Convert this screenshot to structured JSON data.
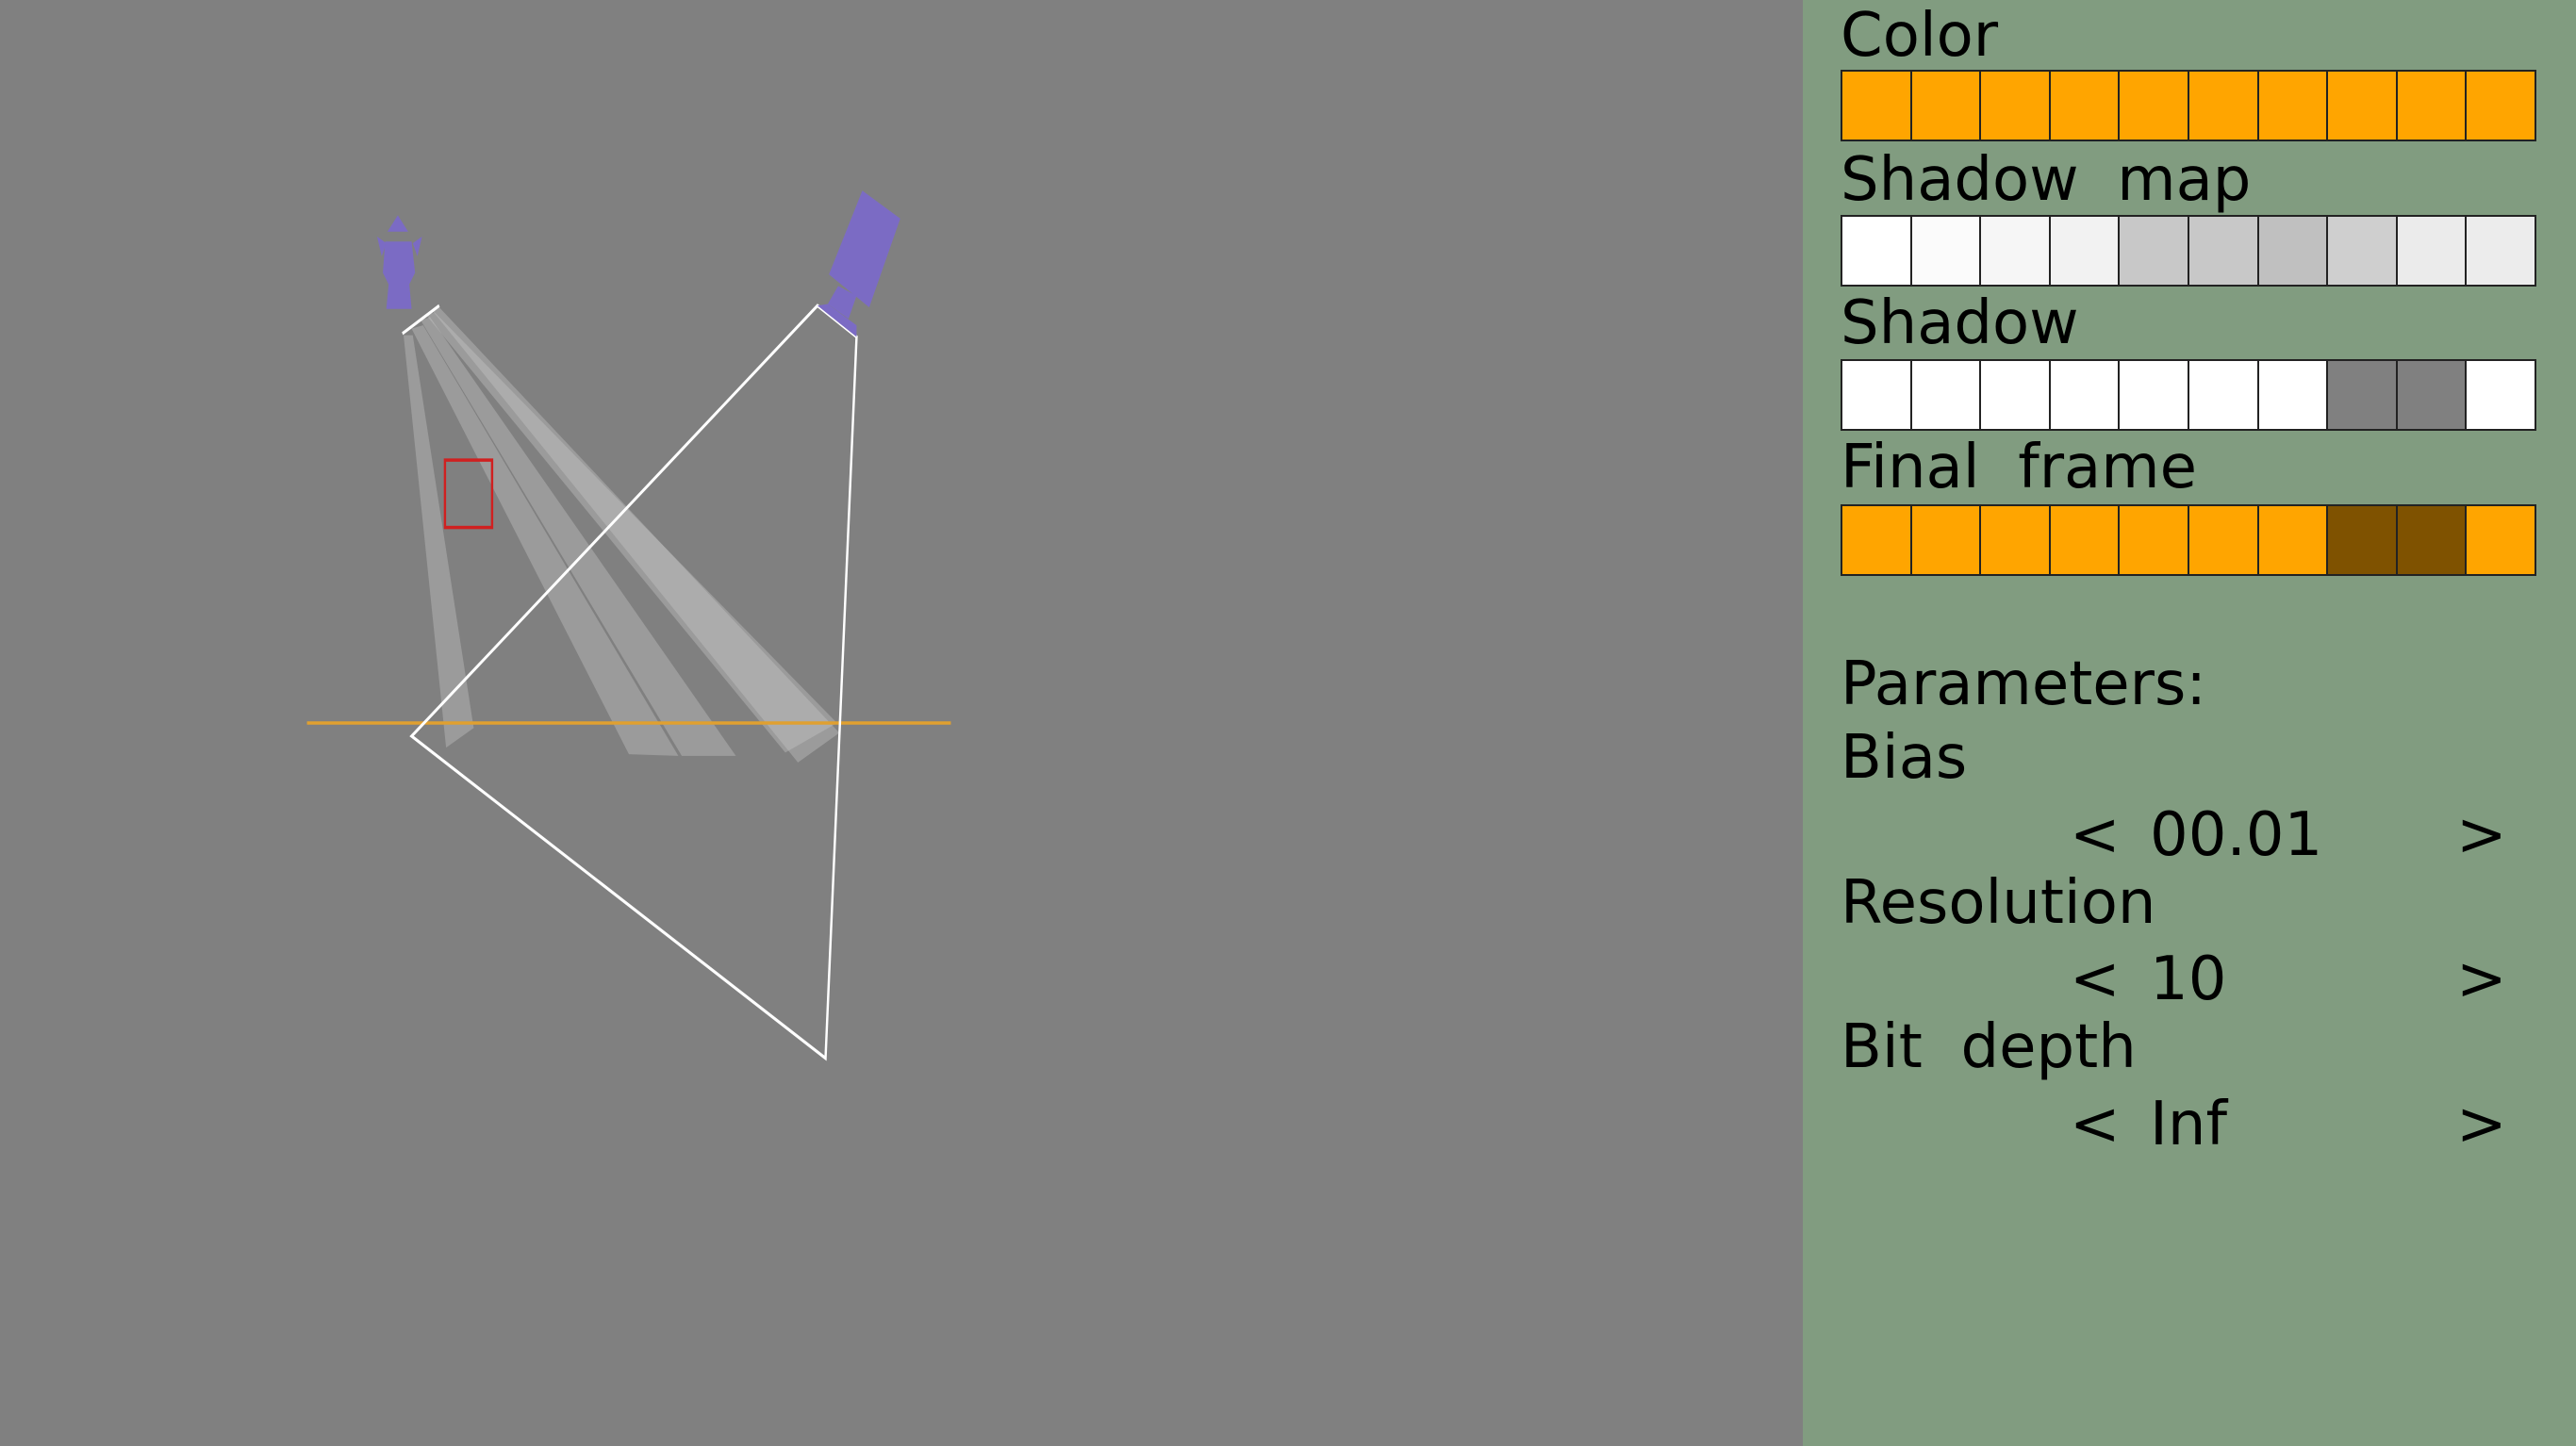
{
  "scene": {
    "background": "#808080",
    "ground_color": "#e0a030",
    "light_color": "#7b6bc4",
    "frustum_color": "#ffffff",
    "marker_color": "#d02020"
  },
  "panel": {
    "background": "#819c80",
    "sections": [
      {
        "label": "Color",
        "cells": [
          "#ffa500",
          "#ffa500",
          "#ffa500",
          "#ffa500",
          "#ffa500",
          "#ffa500",
          "#ffa500",
          "#ffa500",
          "#ffa500",
          "#ffa500"
        ]
      },
      {
        "label": "Shadow  map",
        "cells": [
          "#ffffff",
          "#fbfbfb",
          "#f6f6f6",
          "#f2f2f2",
          "#c8c8c8",
          "#c8c8c8",
          "#c0c0c0",
          "#cfcfcf",
          "#ebebeb",
          "#ececec"
        ]
      },
      {
        "label": "Shadow",
        "cells": [
          "#ffffff",
          "#ffffff",
          "#ffffff",
          "#ffffff",
          "#ffffff",
          "#ffffff",
          "#ffffff",
          "#808080",
          "#808080",
          "#ffffff"
        ]
      },
      {
        "label": "Final  frame",
        "cells": [
          "#ffa500",
          "#ffa500",
          "#ffa500",
          "#ffa500",
          "#ffa500",
          "#ffa500",
          "#ffa500",
          "#7f5200",
          "#7f5200",
          "#ffa500"
        ]
      }
    ],
    "parameters_label": "Parameters:",
    "params": [
      {
        "label": "Bias",
        "value": "00.01",
        "prev": "<",
        "next": ">"
      },
      {
        "label": "Resolution",
        "value": "10",
        "prev": "<",
        "next": ">"
      },
      {
        "label": "Bit  depth",
        "value": "Inf",
        "prev": "<",
        "next": ">"
      }
    ]
  }
}
